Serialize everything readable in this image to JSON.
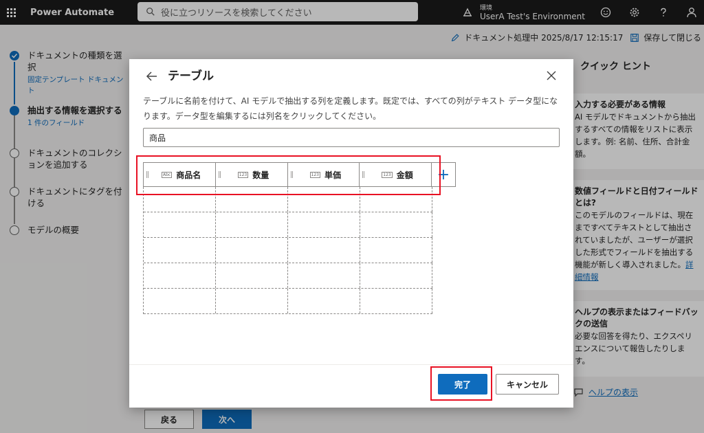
{
  "app": {
    "title": "Power Automate",
    "search_placeholder": "役に立つリソースを検索してください",
    "env_label": "環境",
    "env_name": "UserA Test's Environment"
  },
  "status": {
    "text": "ドキュメント処理中 2025/8/17 12:15:17",
    "save_label": "保存して閉じる"
  },
  "steps": [
    {
      "label": "ドキュメントの種類を選択",
      "sub": "固定テンプレート ドキュメント",
      "state": "done"
    },
    {
      "label": "抽出する情報を選択する",
      "sub": "1 件のフィールド",
      "state": "current"
    },
    {
      "label": "ドキュメントのコレクションを追加する",
      "sub": "",
      "state": "todo"
    },
    {
      "label": "ドキュメントにタグを付ける",
      "sub": "",
      "state": "todo"
    },
    {
      "label": "モデルの概要",
      "sub": "",
      "state": "todo"
    }
  ],
  "hints": {
    "title": "クイック ヒント",
    "cards": [
      {
        "heading": "入力する必要がある情報",
        "body": "AI モデルでドキュメントから抽出するすべての情報をリストに表示します。例: 名前、住所、合計金額。",
        "link": ""
      },
      {
        "heading": "数値フィールドと日付フィールドとは?",
        "body": "このモデルのフィールドは、現在まですべてテキストとして抽出されていましたが、ユーザーが選択した形式でフィールドを抽出する機能が新しく導入されました。",
        "link": "詳細情報"
      },
      {
        "heading": "ヘルプの表示またはフィードバックの送信",
        "body": "必要な回答を得たり、エクスペリエンスについて報告したりします。",
        "link": ""
      }
    ],
    "help_link": "ヘルプの表示"
  },
  "background_buttons": {
    "back": "戻る",
    "next": "次へ"
  },
  "dialog": {
    "title": "テーブル",
    "description": "テーブルに名前を付けて、AI モデルで抽出する列を定義します。既定では、すべての列がテキスト データ型になります。データ型を編集するには列名をクリックしてください。",
    "table_name_value": "商品",
    "columns": [
      {
        "name": "商品名",
        "type_icon": "Abc"
      },
      {
        "name": "数量",
        "type_icon": "123"
      },
      {
        "name": "単価",
        "type_icon": "123"
      },
      {
        "name": "金額",
        "type_icon": "123"
      }
    ],
    "add_column": "+",
    "done_label": "完了",
    "cancel_label": "キャンセル"
  },
  "colors": {
    "accent": "#0f6cbd",
    "topbar": "#1b1b1b",
    "highlight": "#e81123"
  }
}
